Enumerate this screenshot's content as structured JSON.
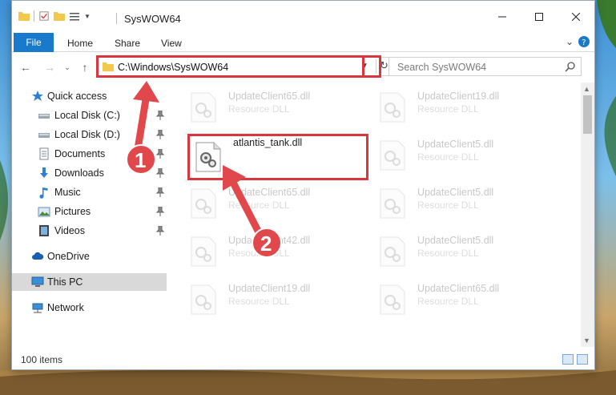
{
  "window": {
    "title": "SysWOW64",
    "colors": {
      "accent": "#1979ca",
      "highlight": "#d9363e",
      "annotation": "#e0484c"
    }
  },
  "ribbon": {
    "tabs": [
      "File",
      "Home",
      "Share",
      "View"
    ]
  },
  "address": {
    "path": "C:\\Windows\\SysWOW64",
    "search_placeholder": "Search SysWOW64"
  },
  "sidebar": {
    "items": [
      {
        "label": "Quick access",
        "icon": "star-icon"
      },
      {
        "label": "Local Disk (C:)",
        "icon": "drive-icon",
        "pinned": true
      },
      {
        "label": "Local Disk (D:)",
        "icon": "drive-icon",
        "pinned": true
      },
      {
        "label": "Documents",
        "icon": "documents-icon",
        "pinned": true
      },
      {
        "label": "Downloads",
        "icon": "downloads-icon",
        "pinned": true
      },
      {
        "label": "Music",
        "icon": "music-icon",
        "pinned": true
      },
      {
        "label": "Pictures",
        "icon": "pictures-icon",
        "pinned": true
      },
      {
        "label": "Videos",
        "icon": "videos-icon",
        "pinned": true
      },
      {
        "label": "OneDrive",
        "icon": "cloud-icon"
      },
      {
        "label": "This PC",
        "icon": "computer-icon",
        "selected": true
      },
      {
        "label": "Network",
        "icon": "network-icon"
      }
    ]
  },
  "files": {
    "left_column": [
      {
        "name": "UpdateClient65.dll",
        "type": "Resource DLL"
      },
      {
        "name": "atlantis_tank.dll",
        "type": ""
      },
      {
        "name": "UpdateClient65.dll",
        "type": "Resource DLL"
      },
      {
        "name": "UpdateClient42.dll",
        "type": "Resource DLL"
      },
      {
        "name": "UpdateClient19.dll",
        "type": "Resource DLL"
      }
    ],
    "right_column": [
      {
        "name": "UpdateClient19.dll",
        "type": "Resource DLL"
      },
      {
        "name": "UpdateClient5.dll",
        "type": "Resource DLL"
      },
      {
        "name": "UpdateClient5.dll",
        "type": "Resource DLL"
      },
      {
        "name": "UpdateClient5.dll",
        "type": "Resource DLL"
      },
      {
        "name": "UpdateClient65.dll",
        "type": "Resource DLL"
      }
    ]
  },
  "status": {
    "item_count": "100 items"
  },
  "annotations": {
    "step1": "1",
    "step2": "2"
  }
}
